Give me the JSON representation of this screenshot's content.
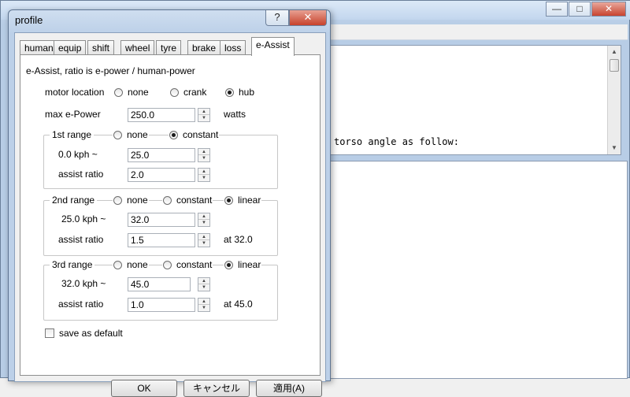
{
  "background_window": {
    "console_text": "torso angle as follow:"
  },
  "dialog": {
    "title": "profile",
    "help_label": "?",
    "close_label": "✕"
  },
  "tabs": [
    {
      "label": "human"
    },
    {
      "label": "equip"
    },
    {
      "label": "shift"
    },
    {
      "label": "wheel"
    },
    {
      "label": "tyre"
    },
    {
      "label": "brake"
    },
    {
      "label": "loss"
    },
    {
      "label": "e-Assist",
      "active": true
    }
  ],
  "eassist": {
    "description": "e-Assist, ratio is e-power / human-power",
    "motor_location": {
      "label": "motor location",
      "options": [
        "none",
        "crank",
        "hub"
      ],
      "selected": "hub"
    },
    "max_power": {
      "label": "max e-Power",
      "value": "250.0",
      "unit": "watts"
    },
    "range1": {
      "title": "1st range",
      "options": [
        "none",
        "constant"
      ],
      "selected": "constant",
      "speed_label": "0.0 kph  ~",
      "speed_value": "25.0",
      "ratio_label": "assist ratio",
      "ratio_value": "2.0"
    },
    "range2": {
      "title": "2nd range",
      "options": [
        "none",
        "constant",
        "linear"
      ],
      "selected": "linear",
      "speed_label": "25.0 kph  ~",
      "speed_value": "32.0",
      "ratio_label": "assist ratio",
      "ratio_value": "1.5",
      "at_label": "at  32.0"
    },
    "range3": {
      "title": "3rd range",
      "options": [
        "none",
        "constant",
        "linear"
      ],
      "selected": "linear",
      "speed_label": "32.0 kph  ~",
      "speed_value": "45.0",
      "ratio_label": "assist ratio",
      "ratio_value": "1.0",
      "at_label": "at  45.0"
    },
    "save_default": {
      "label": "save as default",
      "checked": false
    }
  },
  "buttons": {
    "ok": "OK",
    "cancel": "キャンセル",
    "apply": "適用(A)"
  }
}
